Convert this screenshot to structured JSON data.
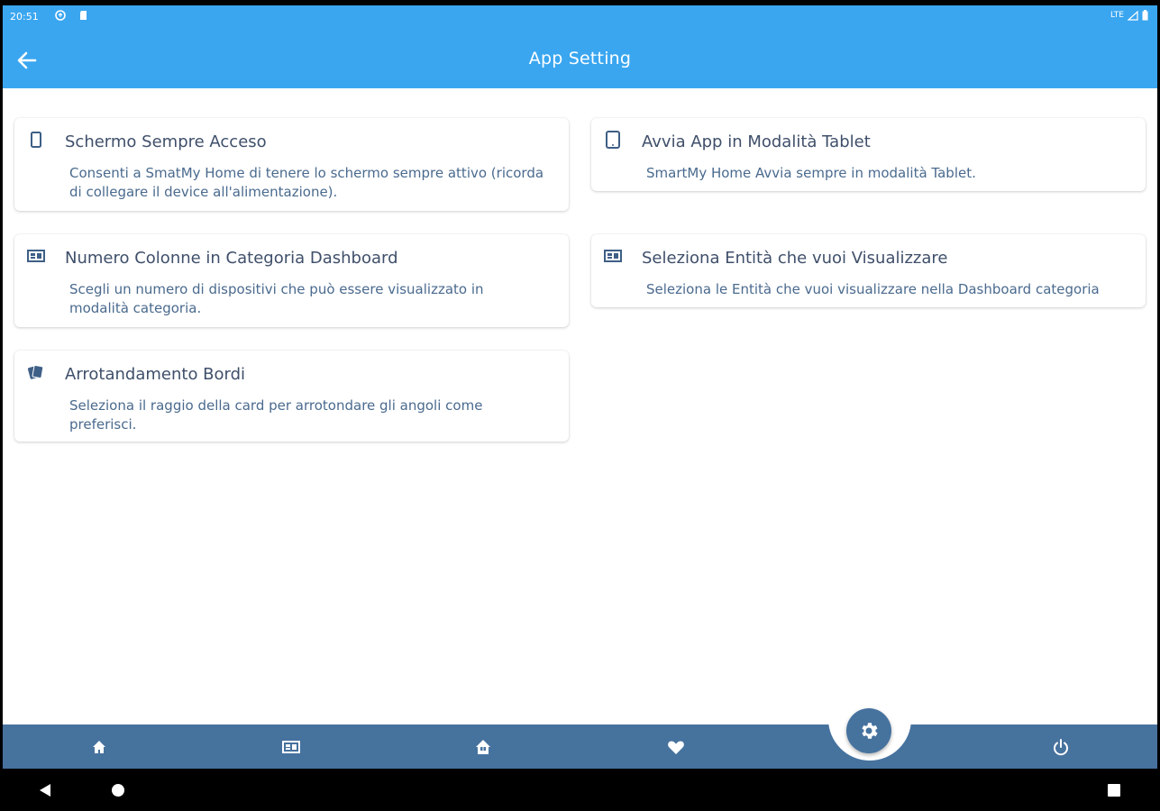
{
  "statusbar": {
    "time": "20:51",
    "network": "LTE"
  },
  "header": {
    "title": "App Setting"
  },
  "settings": [
    {
      "title": "Schermo Sempre Acceso",
      "description": "Consenti a SmatMy Home di tenere lo schermo sempre attivo (ricorda di collegare il device all'alimentazione).",
      "icon": "phone-icon"
    },
    {
      "title": "Avvia App in Modalità Tablet",
      "description": "SmartMy Home Avvia sempre in modalità Tablet.",
      "icon": "tablet-icon"
    },
    {
      "title": "Numero Colonne in Categoria Dashboard",
      "description": "Scegli un numero di dispositivi che può essere visualizzato in modalità categoria.",
      "icon": "dashboard-icon"
    },
    {
      "title": "Seleziona Entità che vuoi Visualizzare",
      "description": "Seleziona le Entità che vuoi visualizzare nella Dashboard categoria",
      "icon": "dashboard-icon"
    },
    {
      "title": "Arrotandamento Bordi",
      "description": "Seleziona il raggio della card per arrotondare gli angoli come preferisci.",
      "icon": "cards-icon"
    }
  ],
  "bottom_nav": {
    "items": [
      "home-icon",
      "dashboard-icon",
      "house-icon",
      "heart-icon",
      "settings-icon",
      "power-icon"
    ],
    "active": "settings-icon"
  },
  "colors": {
    "appbar": "#3aa6f0",
    "bottom_nav": "#46729e",
    "title_text": "#3f4f6a",
    "desc_text": "#4a6a8e"
  }
}
